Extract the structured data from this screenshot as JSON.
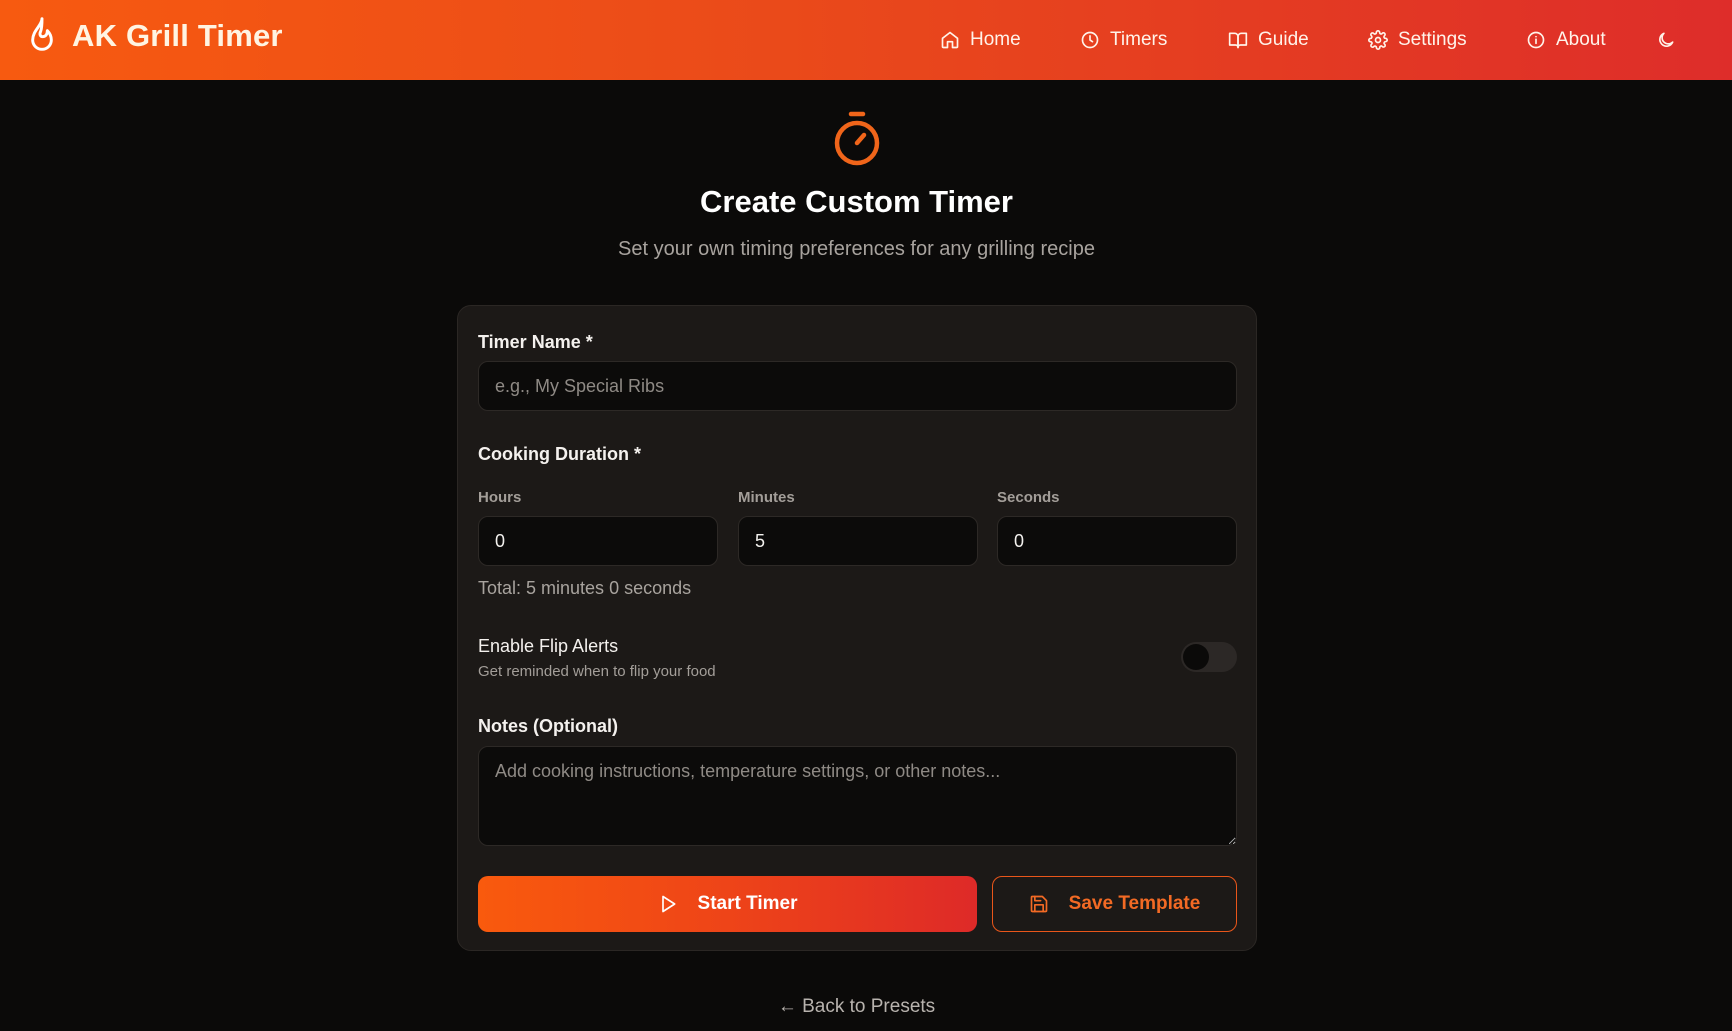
{
  "app": {
    "title": "AK Grill Timer"
  },
  "nav": {
    "items": [
      {
        "label": "Home",
        "icon": "home-icon"
      },
      {
        "label": "Timers",
        "icon": "clock-icon"
      },
      {
        "label": "Guide",
        "icon": "book-icon"
      },
      {
        "label": "Settings",
        "icon": "gear-icon"
      },
      {
        "label": "About",
        "icon": "info-icon"
      }
    ],
    "theme_toggle_icon": "moon-icon"
  },
  "page": {
    "icon": "stopwatch-icon",
    "title": "Create Custom Timer",
    "subtitle": "Set your own timing preferences for any grilling recipe"
  },
  "form": {
    "timer_name": {
      "label": "Timer Name *",
      "value": "",
      "placeholder": "e.g., My Special Ribs"
    },
    "duration": {
      "label": "Cooking Duration *",
      "hours": {
        "label": "Hours",
        "value": "0"
      },
      "minutes": {
        "label": "Minutes",
        "value": "5"
      },
      "seconds": {
        "label": "Seconds",
        "value": "0"
      },
      "total_text": "Total: 5 minutes 0 seconds"
    },
    "flip_alerts": {
      "title": "Enable Flip Alerts",
      "description": "Get reminded when to flip your food",
      "enabled": false
    },
    "notes": {
      "label": "Notes (Optional)",
      "value": "",
      "placeholder": "Add cooking instructions, temperature settings, or other notes..."
    },
    "start_button": {
      "label": "Start Timer",
      "icon": "play-icon"
    },
    "save_button": {
      "label": "Save Template",
      "icon": "save-icon"
    }
  },
  "footer": {
    "back_link": "← Back to Presets"
  },
  "colors": {
    "accent": "#f75a10",
    "accent_end": "#de2d2a",
    "background": "#0b0a09",
    "card": "#1c1917"
  }
}
